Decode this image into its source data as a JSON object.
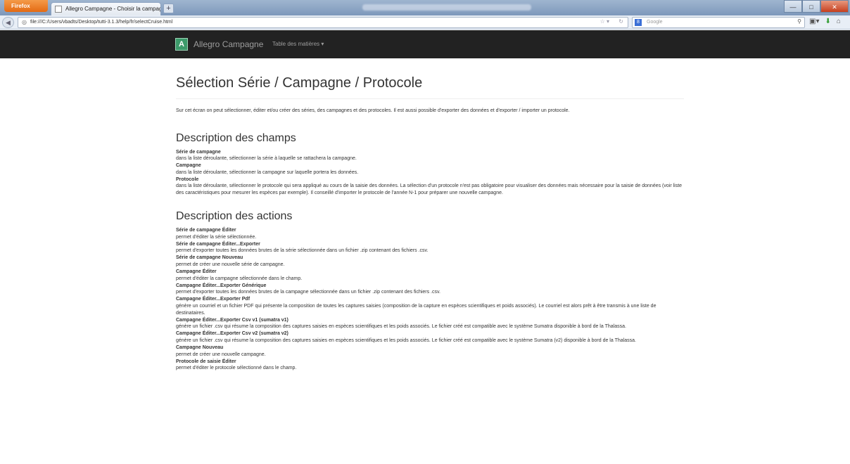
{
  "browser": {
    "menu_button": "Firefox",
    "tab_title": "Allegro Campagne - Choisir la campagne",
    "new_tab": "+",
    "url": "file:///C:/Users/vbadts/Desktop/tutti-3.1.3/help/fr/selectCruise.html",
    "search_placeholder": "Google",
    "window_controls": {
      "minimize": "—",
      "maximize": "□",
      "close": "✕"
    }
  },
  "navbar": {
    "brand": "Allegro Campagne",
    "logo_letter": "A",
    "menu_label": "Table des matières ▾"
  },
  "page": {
    "title": "Sélection Série / Campagne / Protocole",
    "intro": "Sur cet écran on peut sélectionner, éditer et/ou créer des séries, des campagnes et des protocoles. Il est aussi possible d'exporter des données et d'exporter / importer un protocole.",
    "fields_heading": "Description des champs",
    "fields": [
      {
        "term": "Série de campagne",
        "def": "dans la liste déroulante, sélectionner la série à laquelle se rattachera la campagne."
      },
      {
        "term": "Campagne",
        "def": "dans la liste déroulante, sélectionner la campagne sur laquelle portera les données."
      },
      {
        "term": "Protocole",
        "def": "dans la liste déroulante, sélectionner le protocole qui sera appliqué au cours de la saisie des données. La sélection d'un protocole n'est pas obligatoire pour visualiser des données mais nécessaire pour la saisie de données (voir liste des caractéristiques pour mesurer les espèces par exemple). Il conseillé d'importer le protocole de l'année N-1 pour préparer une nouvelle campagne."
      }
    ],
    "actions_heading": "Description des actions",
    "actions": [
      {
        "term": "Série de campagne Éditer",
        "def": "permet d'éditer la série sélectionnée."
      },
      {
        "term": "Série de campagne Éditer...Exporter",
        "def": "permet d'exporter toutes les données brutes de la série sélectionnée dans un fichier .zip contenant des fichiers .csv."
      },
      {
        "term": "Série de campagne Nouveau",
        "def": "permet de créer une nouvelle série de campagne."
      },
      {
        "term": "Campagne Éditer",
        "def": "permet d'éditer la campagne sélectionnée dans le champ."
      },
      {
        "term": "Campagne Éditer...Exporter Générique",
        "def": " permet d'exporter toutes les données brutes de la campagne sélectionnée dans un fichier .zip contenant des fichiers .csv."
      },
      {
        "term": "Campagne Éditer...Exporter Pdf",
        "def": "génère un courriel et un fichier PDF qui présente la composition de toutes les captures saisies (composition de la capture en espèces scientifiques et poids associés). Le courriel est alors prêt à être transmis à une liste de destinataires."
      },
      {
        "term": "Campagne Éditer...Exporter Csv v1 (sumatra v1)",
        "def": "génère un fichier .csv qui résume la composition des captures saisies en espèces scientifiques et les poids associés. Le fichier créé est compatible avec le système Sumatra disponible à bord de la Thalassa."
      },
      {
        "term": "Campagne Éditer...Exporter Csv v2 (sumatra v2)",
        "def": "génère un fichier .csv qui résume la composition des captures saisies en espèces scientifiques et les poids associés. Le fichier créé est compatible avec le système Sumatra (v2) disponible à bord de la Thalassa."
      },
      {
        "term": "Campagne Nouveau",
        "def": "permet de créer une nouvelle campagne."
      },
      {
        "term": "Protocole de saisie Éditer",
        "def": "permet d'éditer le protocole sélectionné dans le champ."
      }
    ]
  }
}
